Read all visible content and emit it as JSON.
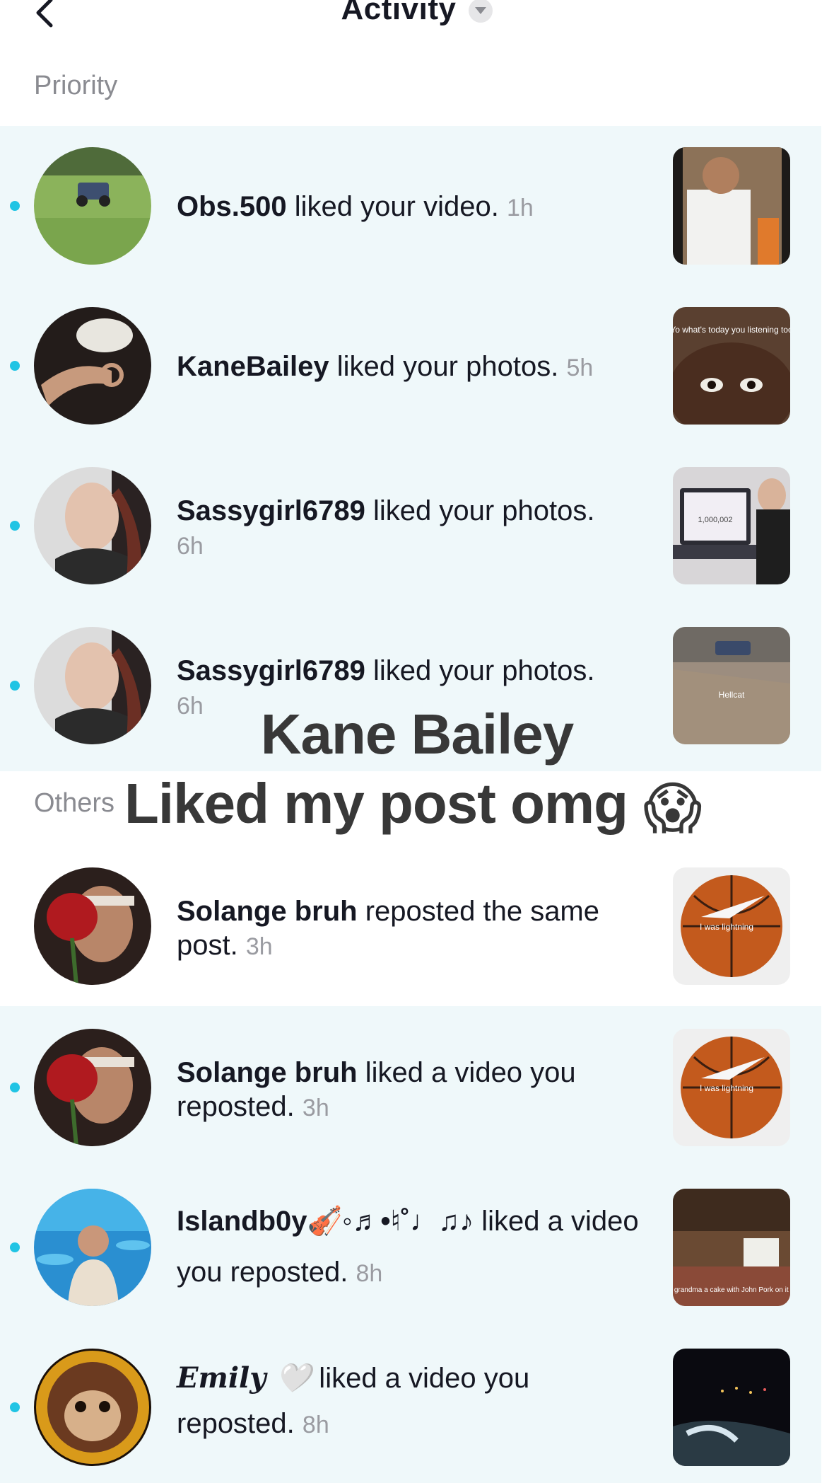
{
  "header": {
    "title": "Activity"
  },
  "sections": {
    "priority_label": "Priority",
    "others_label": "Others"
  },
  "overlay": {
    "line1": "Kane Bailey",
    "line2": "Liked my post omg",
    "emoji": "😱"
  },
  "notifications": [
    {
      "username": "Obs.500",
      "action": " liked your video.",
      "time": "1h",
      "unread": true
    },
    {
      "username": "KaneBailey",
      "action": " liked your photos.",
      "time": "5h",
      "unread": true
    },
    {
      "username": "Sassygirl6789",
      "action": " liked your photos.",
      "time": "6h",
      "unread": true
    },
    {
      "username": "Sassygirl6789",
      "action": " liked your photos.",
      "time": "6h",
      "unread": true
    },
    {
      "username": "Solange bruh",
      "action": " reposted the same post.",
      "time": "3h",
      "unread": false
    },
    {
      "username": "Solange bruh",
      "action": " liked a video you reposted.",
      "time": "3h",
      "unread": true
    },
    {
      "username": "Islandb0y🎻◦♬•♮˚♩♫♪",
      "action": " liked a video you reposted.",
      "time": "8h",
      "unread": true
    },
    {
      "username": "𝑬𝒎𝒊𝒍𝒚 🤍",
      "action": " liked a video you reposted.",
      "time": "8h",
      "unread": true
    }
  ],
  "thumb_captions": {
    "kane": "Yo what's today you listening too",
    "counter": "1,000,002",
    "hellcat": "Hellcat",
    "ball1": "I was lightning",
    "ball2": "I was lightning",
    "grandma": "Giving grandma a cake with John Pork on it for her"
  },
  "colors": {
    "priority_band": "#eff8fa",
    "unread_dot": "#20c4e4",
    "overlay_text": "#383838"
  }
}
